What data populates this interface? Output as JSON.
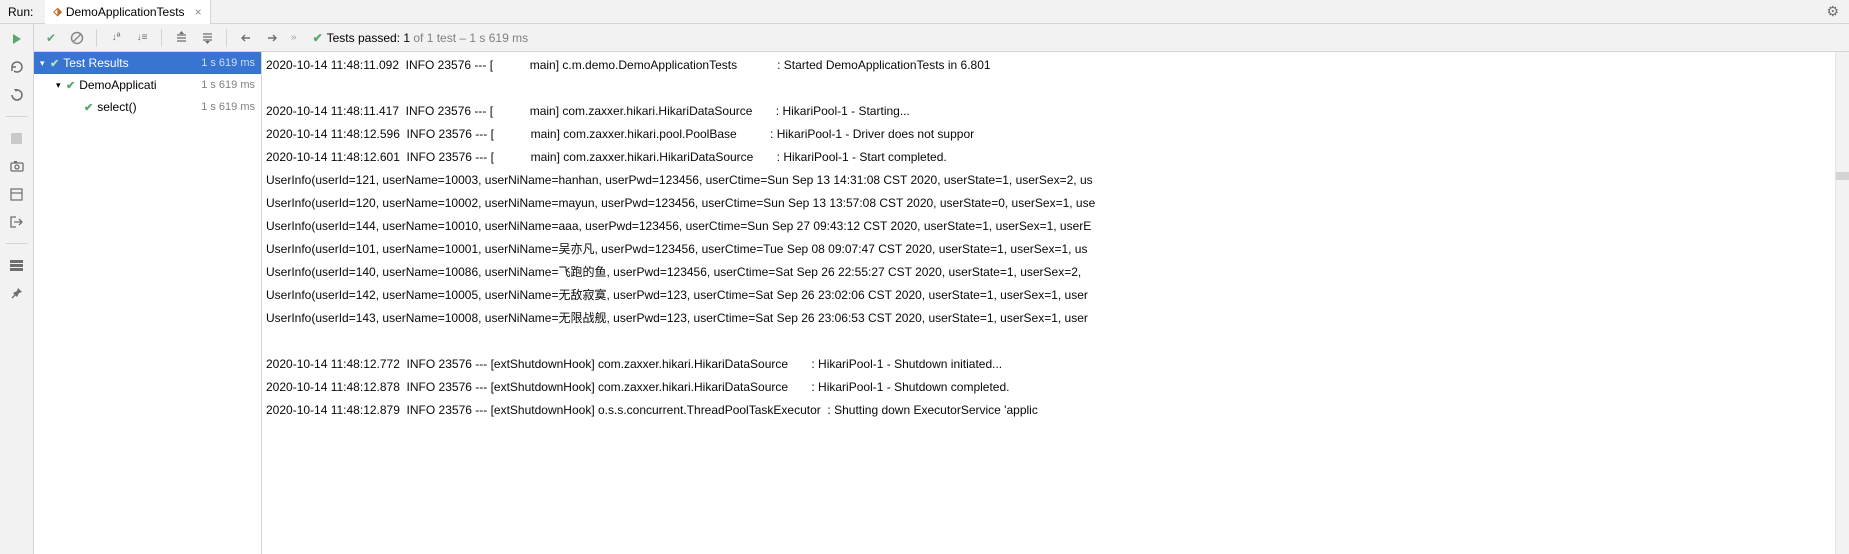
{
  "header": {
    "run_label": "Run:",
    "tab_name": "DemoApplicationTests"
  },
  "toolbar": {
    "status_prefix": "Tests passed: 1",
    "status_suffix": " of 1 test – 1 s 619 ms"
  },
  "tree": {
    "root": {
      "label": "Test Results",
      "time": "1 s 619 ms"
    },
    "node1": {
      "label": "DemoApplicati",
      "time": "1 s 619 ms"
    },
    "node2": {
      "label": "select()",
      "time": "1 s 619 ms"
    }
  },
  "console_lines": [
    "2020-10-14 11:48:11.092  INFO 23576 --- [           main] c.m.demo.DemoApplicationTests            : Started DemoApplicationTests in 6.801",
    "",
    "2020-10-14 11:48:11.417  INFO 23576 --- [           main] com.zaxxer.hikari.HikariDataSource       : HikariPool-1 - Starting...",
    "2020-10-14 11:48:12.596  INFO 23576 --- [           main] com.zaxxer.hikari.pool.PoolBase          : HikariPool-1 - Driver does not suppor",
    "2020-10-14 11:48:12.601  INFO 23576 --- [           main] com.zaxxer.hikari.HikariDataSource       : HikariPool-1 - Start completed.",
    "UserInfo(userId=121, userName=10003, userNiName=hanhan, userPwd=123456, userCtime=Sun Sep 13 14:31:08 CST 2020, userState=1, userSex=2, us",
    "UserInfo(userId=120, userName=10002, userNiName=mayun, userPwd=123456, userCtime=Sun Sep 13 13:57:08 CST 2020, userState=0, userSex=1, use",
    "UserInfo(userId=144, userName=10010, userNiName=aaa, userPwd=123456, userCtime=Sun Sep 27 09:43:12 CST 2020, userState=1, userSex=1, userE",
    "UserInfo(userId=101, userName=10001, userNiName=吴亦凡, userPwd=123456, userCtime=Tue Sep 08 09:07:47 CST 2020, userState=1, userSex=1, us",
    "UserInfo(userId=140, userName=10086, userNiName=飞跑的鱼, userPwd=123456, userCtime=Sat Sep 26 22:55:27 CST 2020, userState=1, userSex=2, ",
    "UserInfo(userId=142, userName=10005, userNiName=无敌寂寞, userPwd=123, userCtime=Sat Sep 26 23:02:06 CST 2020, userState=1, userSex=1, user",
    "UserInfo(userId=143, userName=10008, userNiName=无限战舰, userPwd=123, userCtime=Sat Sep 26 23:06:53 CST 2020, userState=1, userSex=1, user",
    "",
    "2020-10-14 11:48:12.772  INFO 23576 --- [extShutdownHook] com.zaxxer.hikari.HikariDataSource       : HikariPool-1 - Shutdown initiated...",
    "2020-10-14 11:48:12.878  INFO 23576 --- [extShutdownHook] com.zaxxer.hikari.HikariDataSource       : HikariPool-1 - Shutdown completed.",
    "2020-10-14 11:48:12.879  INFO 23576 --- [extShutdownHook] o.s.s.concurrent.ThreadPoolTaskExecutor  : Shutting down ExecutorService 'applic",
    ""
  ]
}
